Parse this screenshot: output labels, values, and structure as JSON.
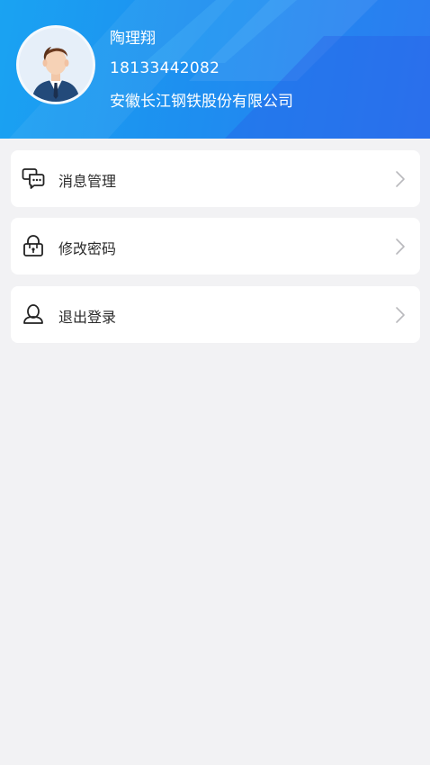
{
  "profile": {
    "name": "陶理翔",
    "phone": "18133442082",
    "company": "安徽长江钢铁股份有限公司",
    "avatar_icon": "user-avatar-icon"
  },
  "menu": {
    "items": [
      {
        "label": "消息管理",
        "icon": "message-icon"
      },
      {
        "label": "修改密码",
        "icon": "lock-icon"
      },
      {
        "label": "退出登录",
        "icon": "user-logout-icon"
      }
    ]
  },
  "colors": {
    "header_start": "#1aa3f2",
    "header_end": "#2c7bf0",
    "background": "#f2f2f4",
    "card": "#ffffff",
    "text": "#2b2b2b"
  }
}
